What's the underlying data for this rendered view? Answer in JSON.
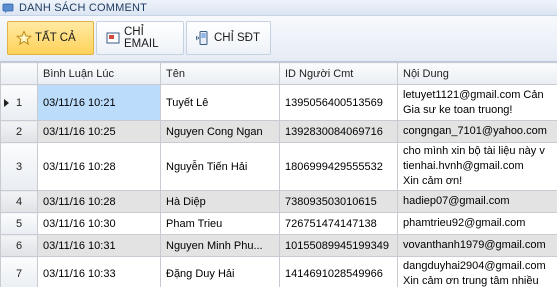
{
  "window": {
    "title": "DANH SÁCH COMMENT"
  },
  "toolbar": {
    "all_label": "TẤT CẢ",
    "email_label": "CHỈ EMAIL",
    "phone_label": "CHỈ SĐT"
  },
  "grid": {
    "columns": [
      "Bình Luận Lúc",
      "Tên",
      "ID Người Cmt",
      "Nội Dung"
    ],
    "rows": [
      {
        "num": "1",
        "time": "03/11/16 10:21",
        "name": "Tuyết Lê",
        "id": "1395056400513569",
        "content": [
          "letuyet1121@gmail.com Cản",
          "Gia sư ke toan truong!"
        ]
      },
      {
        "num": "2",
        "time": "03/11/16 10:25",
        "name": "Nguyen Cong Ngan",
        "id": "1392830084069716",
        "content": [
          "congngan_7101@yahoo.com"
        ]
      },
      {
        "num": "3",
        "time": "03/11/16 10:28",
        "name": "Nguyễn Tiến Hải",
        "id": "1806999429555532",
        "content": [
          "cho mình xin bộ tài liệu này v",
          "tienhai.hvnh@gmail.com",
          "Xin cảm ơn!"
        ]
      },
      {
        "num": "4",
        "time": "03/11/16 10:28",
        "name": "Hà Diệp",
        "id": "738093503010615",
        "content": [
          "hadiep07@gmail.com"
        ]
      },
      {
        "num": "5",
        "time": "03/11/16 10:30",
        "name": "Pham Trieu",
        "id": "726751474147138",
        "content": [
          "phamtrieu92@gmail.com"
        ]
      },
      {
        "num": "6",
        "time": "03/11/16 10:31",
        "name": "Nguyen Minh Phu...",
        "id": "10155089945199349",
        "content": [
          "vovanthanh1979@gmail.com"
        ]
      },
      {
        "num": "7",
        "time": "03/11/16 10:33",
        "name": "Đặng Duy Hải",
        "id": "1414691028549966",
        "content": [
          "dangduyhai2904@gmail.com",
          "Xin cảm ơn trung tâm nhiều"
        ]
      }
    ]
  },
  "colors": {
    "selected_cell": "#bbdcfb",
    "alt_row": "#e3e3e3",
    "active_button": "#ffd25a"
  },
  "icons": [
    "comment-list-icon",
    "star-icon",
    "email-icon",
    "phone-icon",
    "current-row-arrow-icon"
  ]
}
